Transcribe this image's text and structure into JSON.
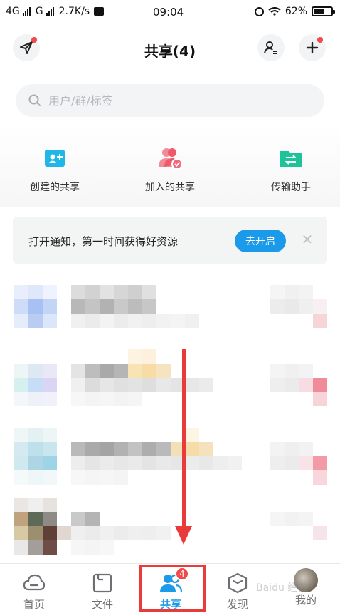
{
  "status_bar": {
    "network1": "4G",
    "network2": "G",
    "speed": "2.7K/s",
    "time": "09:04",
    "battery_percent": "62%",
    "battery_level": 0.62
  },
  "header": {
    "title": "共享(4)"
  },
  "search": {
    "placeholder": "用户/群/标签"
  },
  "quick_actions": [
    {
      "label": "创建的共享",
      "icon": "folder-add-icon",
      "color": "#1fb6e8"
    },
    {
      "label": "加入的共享",
      "icon": "group-check-icon",
      "color": "#f06a7a"
    },
    {
      "label": "传输助手",
      "icon": "transfer-folder-icon",
      "color": "#1fc39a"
    }
  ],
  "notice": {
    "text": "打开通知，第一时间获得好资源",
    "button": "去开启"
  },
  "tabs": [
    {
      "label": "首页",
      "icon": "home-cloud-icon",
      "active": false
    },
    {
      "label": "文件",
      "icon": "folder-icon",
      "active": false
    },
    {
      "label": "共享",
      "icon": "share-people-icon",
      "active": true,
      "badge": "4"
    },
    {
      "label": "发现",
      "icon": "discover-cube-icon",
      "active": false
    },
    {
      "label": "我的",
      "icon": "avatar",
      "active": false
    }
  ],
  "colors": {
    "accent": "#1a9ae8",
    "badge": "#f04a4a",
    "annotation": "#ea3b3b"
  },
  "watermark": "Baidu 经验"
}
